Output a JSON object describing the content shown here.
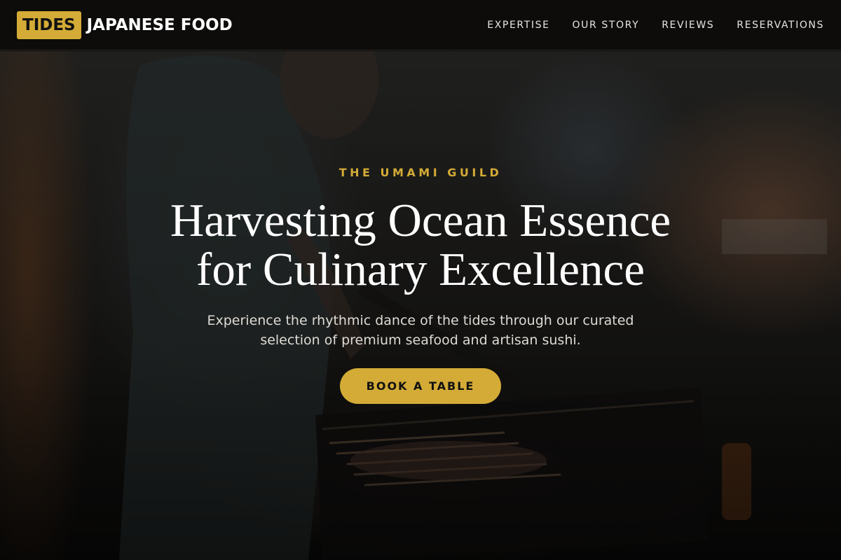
{
  "header": {
    "logo_badge": "TIDES",
    "logo_text": "JAPANESE FOOD",
    "nav": [
      {
        "label": "EXPERTISE"
      },
      {
        "label": "OUR STORY"
      },
      {
        "label": "REVIEWS"
      },
      {
        "label": "RESERVATIONS"
      }
    ]
  },
  "hero": {
    "eyebrow": "THE UMAMI GUILD",
    "headline_line1": "Harvesting Ocean Essence",
    "headline_line2": "for Culinary Excellence",
    "subtitle_line1": "Experience the rhythmic dance of the tides through our curated",
    "subtitle_line2": "selection of premium seafood and artisan sushi.",
    "cta_label": "BOOK A TABLE"
  },
  "colors": {
    "accent": "#d4ab36",
    "header_bg": "#0d0c0b",
    "text_light": "#ffffff"
  }
}
